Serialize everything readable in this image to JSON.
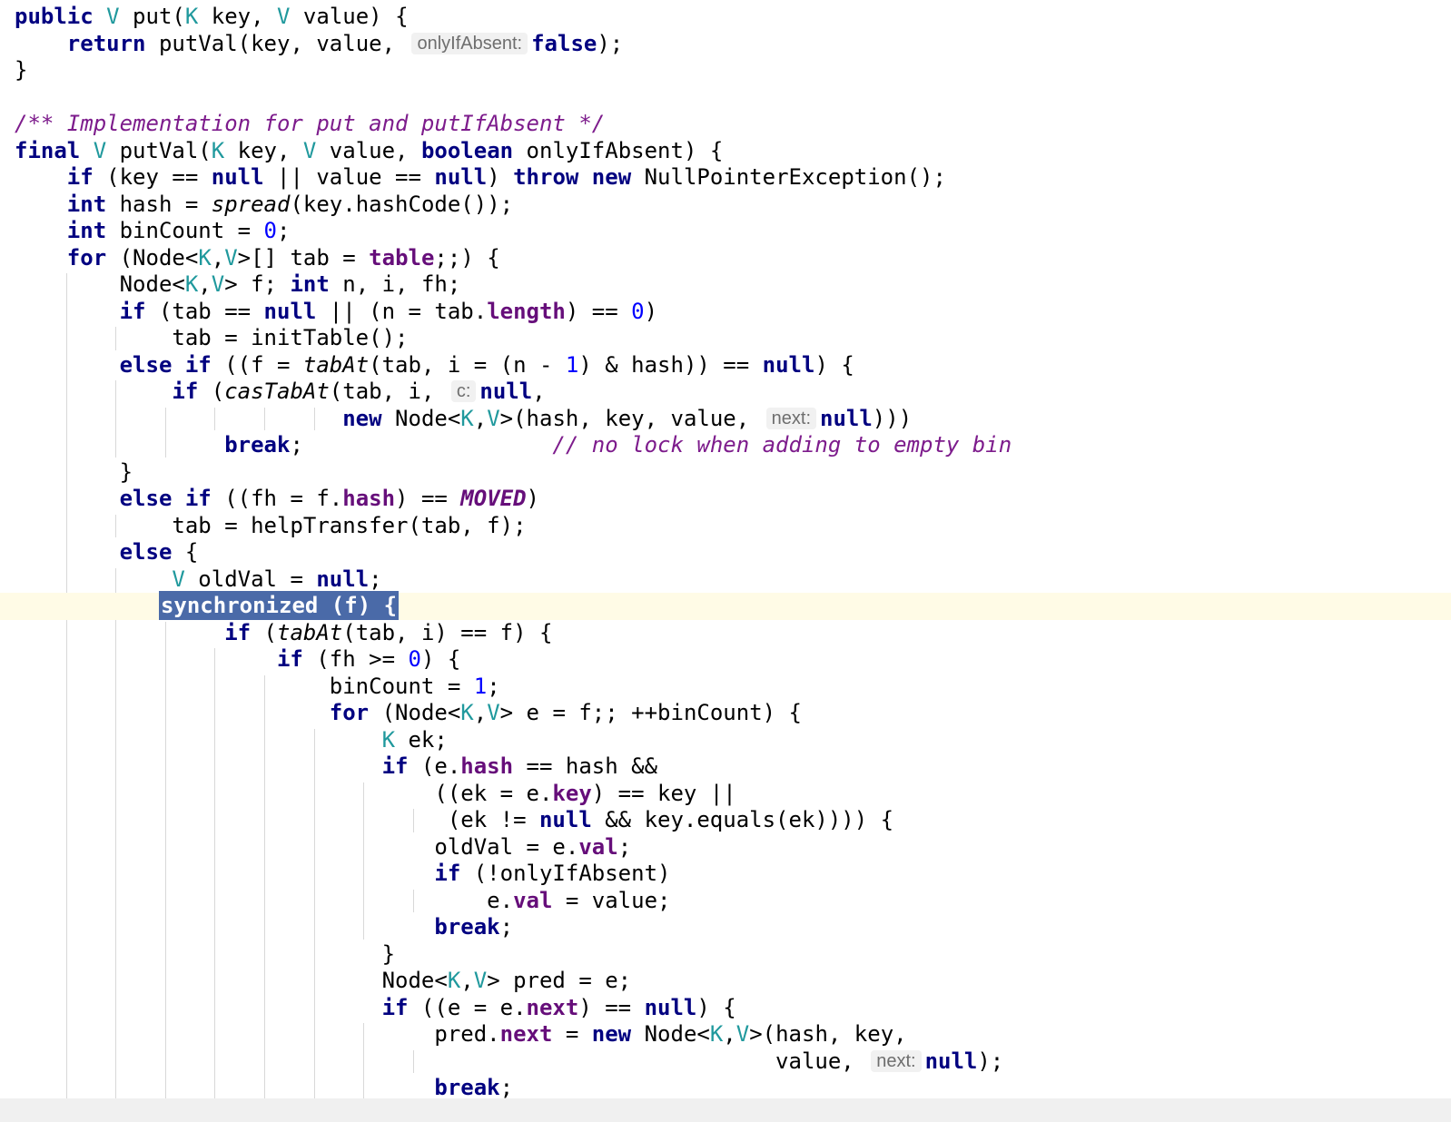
{
  "editor": {
    "lines": [
      [
        [
          "kw",
          "public"
        ],
        [
          "t",
          " "
        ],
        [
          "tp",
          "V"
        ],
        [
          "t",
          " put("
        ],
        [
          "tp",
          "K"
        ],
        [
          "t",
          " key, "
        ],
        [
          "tp",
          "V"
        ],
        [
          "t",
          " value) {"
        ]
      ],
      [
        [
          "t",
          "    "
        ],
        [
          "kw",
          "return"
        ],
        [
          "t",
          " putVal(key, value, "
        ],
        [
          "hint",
          "onlyIfAbsent:"
        ],
        [
          "kw",
          "false"
        ],
        [
          "t",
          ");"
        ]
      ],
      [
        [
          "t",
          "}"
        ]
      ],
      [],
      [
        [
          "cm",
          "/** Implementation for put and putIfAbsent */"
        ]
      ],
      [
        [
          "kw",
          "final"
        ],
        [
          "t",
          " "
        ],
        [
          "tp",
          "V"
        ],
        [
          "t",
          " putVal("
        ],
        [
          "tp",
          "K"
        ],
        [
          "t",
          " key, "
        ],
        [
          "tp",
          "V"
        ],
        [
          "t",
          " value, "
        ],
        [
          "kw",
          "boolean"
        ],
        [
          "t",
          " onlyIfAbsent) {"
        ]
      ],
      [
        [
          "t",
          "    "
        ],
        [
          "kw",
          "if"
        ],
        [
          "t",
          " (key == "
        ],
        [
          "kw",
          "null"
        ],
        [
          "t",
          " || value == "
        ],
        [
          "kw",
          "null"
        ],
        [
          "t",
          ") "
        ],
        [
          "kw",
          "throw new"
        ],
        [
          "t",
          " NullPointerException();"
        ]
      ],
      [
        [
          "t",
          "    "
        ],
        [
          "kw",
          "int"
        ],
        [
          "t",
          " hash = "
        ],
        [
          "it",
          "spread"
        ],
        [
          "t",
          "(key.hashCode());"
        ]
      ],
      [
        [
          "t",
          "    "
        ],
        [
          "kw",
          "int"
        ],
        [
          "t",
          " binCount = "
        ],
        [
          "nm",
          "0"
        ],
        [
          "t",
          ";"
        ]
      ],
      [
        [
          "t",
          "    "
        ],
        [
          "kw",
          "for"
        ],
        [
          "t",
          " (Node<"
        ],
        [
          "tp",
          "K"
        ],
        [
          "t",
          ","
        ],
        [
          "tp",
          "V"
        ],
        [
          "t",
          ">[] tab = "
        ],
        [
          "fd",
          "table"
        ],
        [
          "t",
          ";;) {"
        ]
      ],
      [
        [
          "t",
          "        Node<"
        ],
        [
          "tp",
          "K"
        ],
        [
          "t",
          ","
        ],
        [
          "tp",
          "V"
        ],
        [
          "t",
          "> f; "
        ],
        [
          "kw",
          "int"
        ],
        [
          "t",
          " n, i, fh;"
        ]
      ],
      [
        [
          "t",
          "        "
        ],
        [
          "kw",
          "if"
        ],
        [
          "t",
          " (tab == "
        ],
        [
          "kw",
          "null"
        ],
        [
          "t",
          " || (n = tab."
        ],
        [
          "fd",
          "length"
        ],
        [
          "t",
          ") == "
        ],
        [
          "nm",
          "0"
        ],
        [
          "t",
          ")"
        ]
      ],
      [
        [
          "t",
          "            tab = initTable();"
        ]
      ],
      [
        [
          "t",
          "        "
        ],
        [
          "kw",
          "else if"
        ],
        [
          "t",
          " ((f = "
        ],
        [
          "it",
          "tabAt"
        ],
        [
          "t",
          "(tab, i = (n - "
        ],
        [
          "nm",
          "1"
        ],
        [
          "t",
          ") & hash)) == "
        ],
        [
          "kw",
          "null"
        ],
        [
          "t",
          ") {"
        ]
      ],
      [
        [
          "t",
          "            "
        ],
        [
          "kw",
          "if"
        ],
        [
          "t",
          " ("
        ],
        [
          "it",
          "casTabAt"
        ],
        [
          "t",
          "(tab, i, "
        ],
        [
          "hint",
          "c:"
        ],
        [
          "kw",
          "null"
        ],
        [
          "t",
          ","
        ]
      ],
      [
        [
          "t",
          "                         "
        ],
        [
          "kw",
          "new"
        ],
        [
          "t",
          " Node<"
        ],
        [
          "tp",
          "K"
        ],
        [
          "t",
          ","
        ],
        [
          "tp",
          "V"
        ],
        [
          "t",
          ">(hash, key, value, "
        ],
        [
          "hint",
          "next:"
        ],
        [
          "kw",
          "null"
        ],
        [
          "t",
          ")))"
        ]
      ],
      [
        [
          "t",
          "                "
        ],
        [
          "kw",
          "break"
        ],
        [
          "t",
          ";                   "
        ],
        [
          "cm",
          "// no lock when adding to empty bin"
        ]
      ],
      [
        [
          "t",
          "        }"
        ]
      ],
      [
        [
          "t",
          "        "
        ],
        [
          "kw",
          "else if"
        ],
        [
          "t",
          " ((fh = f."
        ],
        [
          "fd",
          "hash"
        ],
        [
          "t",
          ") == "
        ],
        [
          "ct",
          "MOVED"
        ],
        [
          "t",
          ")"
        ]
      ],
      [
        [
          "t",
          "            tab = helpTransfer(tab, f);"
        ]
      ],
      [
        [
          "t",
          "        "
        ],
        [
          "kw",
          "else"
        ],
        [
          "t",
          " {"
        ]
      ],
      [
        [
          "t",
          "            "
        ],
        [
          "tp",
          "V"
        ],
        [
          "t",
          " oldVal = "
        ],
        [
          "kw",
          "null"
        ],
        [
          "t",
          ";"
        ]
      ],
      [
        [
          "t",
          "           "
        ],
        [
          "sel",
          "synchronized (f) {"
        ]
      ],
      [
        [
          "t",
          "                "
        ],
        [
          "kw",
          "if"
        ],
        [
          "t",
          " ("
        ],
        [
          "it",
          "tabAt"
        ],
        [
          "t",
          "(tab, i) == f) {"
        ]
      ],
      [
        [
          "t",
          "                    "
        ],
        [
          "kw",
          "if"
        ],
        [
          "t",
          " (fh >= "
        ],
        [
          "nm",
          "0"
        ],
        [
          "t",
          ") {"
        ]
      ],
      [
        [
          "t",
          "                        binCount = "
        ],
        [
          "nm",
          "1"
        ],
        [
          "t",
          ";"
        ]
      ],
      [
        [
          "t",
          "                        "
        ],
        [
          "kw",
          "for"
        ],
        [
          "t",
          " (Node<"
        ],
        [
          "tp",
          "K"
        ],
        [
          "t",
          ","
        ],
        [
          "tp",
          "V"
        ],
        [
          "t",
          "> e = f;; ++binCount) {"
        ]
      ],
      [
        [
          "t",
          "                            "
        ],
        [
          "tp",
          "K"
        ],
        [
          "t",
          " ek;"
        ]
      ],
      [
        [
          "t",
          "                            "
        ],
        [
          "kw",
          "if"
        ],
        [
          "t",
          " (e."
        ],
        [
          "fd",
          "hash"
        ],
        [
          "t",
          " == hash &&"
        ]
      ],
      [
        [
          "t",
          "                                ((ek = e."
        ],
        [
          "fd",
          "key"
        ],
        [
          "t",
          ") == key ||"
        ]
      ],
      [
        [
          "t",
          "                                 (ek != "
        ],
        [
          "kw",
          "null"
        ],
        [
          "t",
          " && key.equals(ek)))) {"
        ]
      ],
      [
        [
          "t",
          "                                oldVal = e."
        ],
        [
          "fd",
          "val"
        ],
        [
          "t",
          ";"
        ]
      ],
      [
        [
          "t",
          "                                "
        ],
        [
          "kw",
          "if"
        ],
        [
          "t",
          " (!onlyIfAbsent)"
        ]
      ],
      [
        [
          "t",
          "                                    e."
        ],
        [
          "fd",
          "val"
        ],
        [
          "t",
          " = value;"
        ]
      ],
      [
        [
          "t",
          "                                "
        ],
        [
          "kw",
          "break"
        ],
        [
          "t",
          ";"
        ]
      ],
      [
        [
          "t",
          "                            }"
        ]
      ],
      [
        [
          "t",
          "                            Node<"
        ],
        [
          "tp",
          "K"
        ],
        [
          "t",
          ","
        ],
        [
          "tp",
          "V"
        ],
        [
          "t",
          "> pred = e;"
        ]
      ],
      [
        [
          "t",
          "                            "
        ],
        [
          "kw",
          "if"
        ],
        [
          "t",
          " ((e = e."
        ],
        [
          "fd",
          "next"
        ],
        [
          "t",
          ") == "
        ],
        [
          "kw",
          "null"
        ],
        [
          "t",
          ") {"
        ]
      ],
      [
        [
          "t",
          "                                pred."
        ],
        [
          "fd",
          "next"
        ],
        [
          "t",
          " = "
        ],
        [
          "kw",
          "new"
        ],
        [
          "t",
          " Node<"
        ],
        [
          "tp",
          "K"
        ],
        [
          "t",
          ","
        ],
        [
          "tp",
          "V"
        ],
        [
          "t",
          ">(hash, key,"
        ]
      ],
      [
        [
          "t",
          "                                                          value, "
        ],
        [
          "hint",
          "next:"
        ],
        [
          "kw",
          "null"
        ],
        [
          "t",
          ");"
        ]
      ],
      [
        [
          "t",
          "                                "
        ],
        [
          "kw",
          "break"
        ],
        [
          "t",
          ";"
        ]
      ]
    ]
  }
}
